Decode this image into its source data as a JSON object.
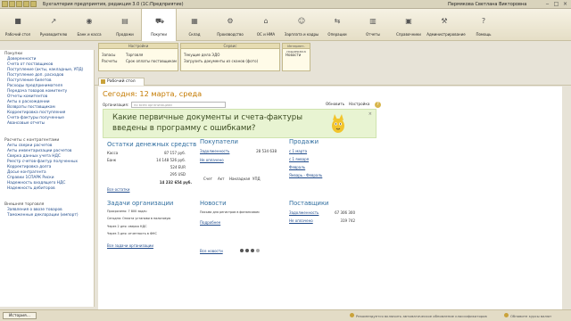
{
  "window": {
    "title": "Бухгалтерия предприятия, редакция 3.0 (1С:Предприятие)",
    "user": "Пермякова Светлана Викторовна",
    "controls": [
      "‒",
      "□",
      "×"
    ]
  },
  "sections": [
    {
      "label": "Рабочий стол",
      "icon": "■"
    },
    {
      "label": "Руководителю",
      "icon": "↗"
    },
    {
      "label": "Банк и касса",
      "icon": "◉"
    },
    {
      "label": "Продажи",
      "icon": "▤"
    },
    {
      "label": "Покупки",
      "icon": "⛟"
    },
    {
      "label": "Склад",
      "icon": "▦"
    },
    {
      "label": "Производство",
      "icon": "⚙"
    },
    {
      "label": "ОС и НМА",
      "icon": "⌂"
    },
    {
      "label": "Зарплата и кадры",
      "icon": "☺"
    },
    {
      "label": "Операции",
      "icon": "⇆"
    },
    {
      "label": "Отчеты",
      "icon": "▥"
    },
    {
      "label": "Справочники",
      "icon": "▣"
    },
    {
      "label": "Администрирование",
      "icon": "⚒"
    },
    {
      "label": "Помощь",
      "icon": "?"
    }
  ],
  "submenu": {
    "groups": [
      {
        "header": "Настройки",
        "items": [
          "Запасы",
          "Расчеты",
          "Торговля",
          "Срок оплаты поставщикам"
        ]
      },
      {
        "header": "Сервис",
        "items": [
          "Текущие дела ЭДО",
          "Загрузить документы из сканов (фото)"
        ]
      },
      {
        "header": "Интернет-поддержка",
        "items": [
          "Новости"
        ]
      }
    ]
  },
  "sidebar": {
    "header1": "Покупки",
    "items1": [
      "Доверенности",
      "Счета от поставщиков",
      "Поступление (акты, накладные, УПД)",
      "Поступление доп. расходов",
      "Поступление билетов",
      "Расходы предпринимателя",
      "Передача товаров комитенту",
      "Отчеты комитентов",
      "Акты о расхождении",
      "Возвраты поставщикам",
      "Корректировка поступления",
      "Счета-фактуры полученные",
      "Авансовые отчеты"
    ],
    "header2": "Расчеты с контрагентами",
    "items2": [
      "Акты сверки расчетов",
      "Акты инвентаризации расчетов",
      "Сверка данных учета НДС",
      "Реестр счетов-фактур полученных",
      "Корректировка долга",
      "Досье контрагента",
      "Справки 1СПАРК Риски",
      "Надежность входящего НДС",
      "Надежность дебиторов"
    ],
    "header3": "Внешняя торговля",
    "items3": [
      "Заявления о ввозе товаров",
      "Таможенные декларации (импорт)"
    ]
  },
  "tabs": {
    "home_label": "Рабочий стол"
  },
  "desktop": {
    "date": "Сегодня: 12 марта, среда",
    "org_label": "Организация:",
    "org_placeholder": "по всем организациям",
    "refresh": "Обновить",
    "settings": "Настройка",
    "banner_text": "Какие первичные документы и счета-фактуры введены в программу с ошибками?",
    "banner_close": "×",
    "cash": {
      "title": "Остатки денежных средств",
      "rows": [
        {
          "label": "Касса",
          "value": "87 157 руб."
        },
        {
          "label": "Банк",
          "value": "14 148 526 руб."
        },
        {
          "label": "",
          "value": "524 EUR"
        },
        {
          "label": "",
          "value": "295 USD"
        }
      ],
      "total": "14 232 654 руб.",
      "link": "Все остатки"
    },
    "buyers": {
      "title": "Покупатели",
      "debt_label": "Задолженность",
      "debt_value": "28 534 638",
      "overdue_label": "Не оплачено",
      "tabs": [
        "Счет",
        "Акт",
        "Накладная",
        "УПД"
      ]
    },
    "sales": {
      "title": "Продажи",
      "links": [
        "с 1 марта",
        "с 1 января",
        "Февраль",
        "Январь - Февраль"
      ]
    },
    "tasks": {
      "title": "Задачи организации",
      "items": [
        "Просрочено: 7 800 задач",
        "Сегодня: Оплата установи в налоговую",
        "Через 2 дня: сверка НДС",
        "Через 3 дня: отчетность в ФНС"
      ],
      "link": "Все задачи организации"
    },
    "news": {
      "title": "Новости",
      "text": "Письма для регистров в финансовом",
      "more": "Подробнее",
      "link": "Все новости"
    },
    "suppliers": {
      "title": "Поставщики",
      "debt_label": "Задолженность",
      "debt_value": "67 306 300",
      "overdue_label": "Не оплачено",
      "overdue_value": "319 742"
    }
  },
  "status": {
    "history": "История...",
    "auto_update": "Рекомендуется включить автоматическое обновление классификаторов",
    "other_rates": "Обновите курсы валют"
  },
  "colors": {
    "accent": "#c47a00",
    "link": "#1f4a8a",
    "header_blue": "#2e6c9e",
    "banner": "#e8f4d2"
  }
}
